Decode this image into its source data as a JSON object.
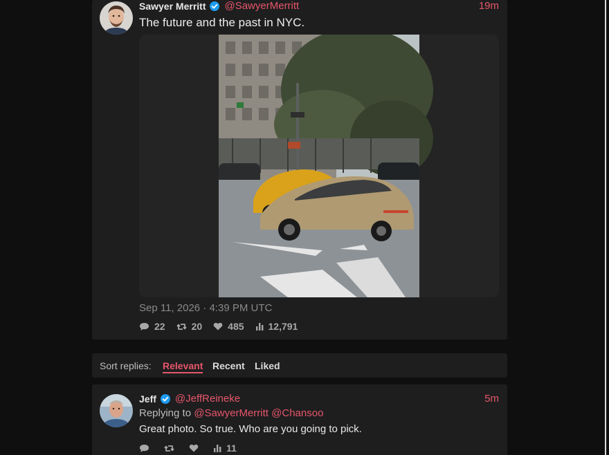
{
  "tweet": {
    "display_name": "Sawyer Merritt",
    "handle": "@SawyerMerritt",
    "time": "19m",
    "text": "The future and the past in NYC.",
    "media_icon": "photo-cybercab-nyc-street",
    "date": "Sep 11, 2026 · 4:39 PM UTC",
    "stats": {
      "replies": "22",
      "retweets": "20",
      "likes": "485",
      "views": "12,791"
    }
  },
  "sort": {
    "label": "Sort replies:",
    "tabs": [
      "Relevant",
      "Recent",
      "Liked"
    ],
    "active": "Relevant"
  },
  "reply": {
    "display_name": "Jeff",
    "handle": "@JeffReineke",
    "time": "5m",
    "replying_prefix": "Replying to",
    "replying_to": [
      "@SawyerMerritt",
      "@Chansoo"
    ],
    "text": "Great photo.  So true. Who are you going to pick.",
    "stats": {
      "views": "11"
    }
  },
  "colors": {
    "accent": "#e7566a",
    "verified": "#1d9bf0",
    "card": "#1e1e1f",
    "background": "#0f0f10"
  },
  "icons": [
    "verified-icon",
    "comment-icon",
    "retweet-icon",
    "heart-icon",
    "views-icon"
  ]
}
